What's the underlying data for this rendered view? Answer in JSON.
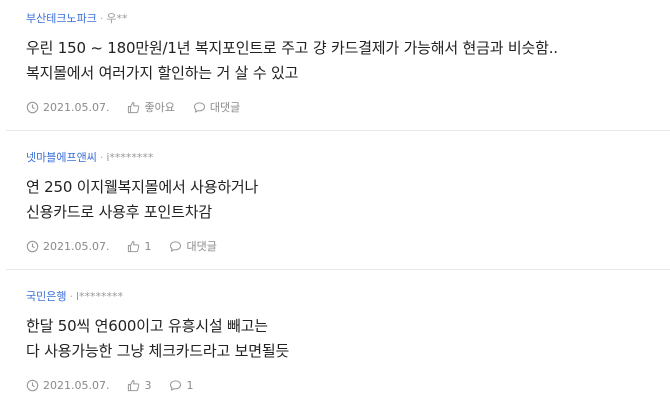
{
  "comments": [
    {
      "company": "부산테크노파크",
      "separator": "·",
      "user": "우**",
      "lines": [
        "우린 150 ~ 180만원/1년 복지포인트로 주고 걍 카드결제가 가능해서 현금과 비슷함..",
        "복지몰에서 여러가지 할인하는 거 살 수 있고"
      ],
      "date": "2021.05.07.",
      "like_label": "좋아요",
      "reply_label": "대댓글"
    },
    {
      "company": "넷마블에프앤씨",
      "separator": "·",
      "user": "i********",
      "lines": [
        "연 250 이지웰복지몰에서 사용하거나",
        "신용카드로 사용후 포인트차감"
      ],
      "date": "2021.05.07.",
      "like_label": "1",
      "reply_label": "대댓글"
    },
    {
      "company": "국민은행",
      "separator": "·",
      "user": "l********",
      "lines": [
        "한달 50씩 연600이고 유흥시설 빼고는",
        "다 사용가능한 그냥 체크카드라고 보면될듯"
      ],
      "date": "2021.05.07.",
      "like_label": "3",
      "reply_label": "1"
    }
  ],
  "icons": {
    "clock": "clock-icon",
    "like": "thumbs-up-icon",
    "reply": "speech-bubble-icon"
  },
  "colors": {
    "company_link": "#3a6fd8",
    "meta_gray": "#8a8a8a",
    "divider": "#e9e9e9"
  }
}
